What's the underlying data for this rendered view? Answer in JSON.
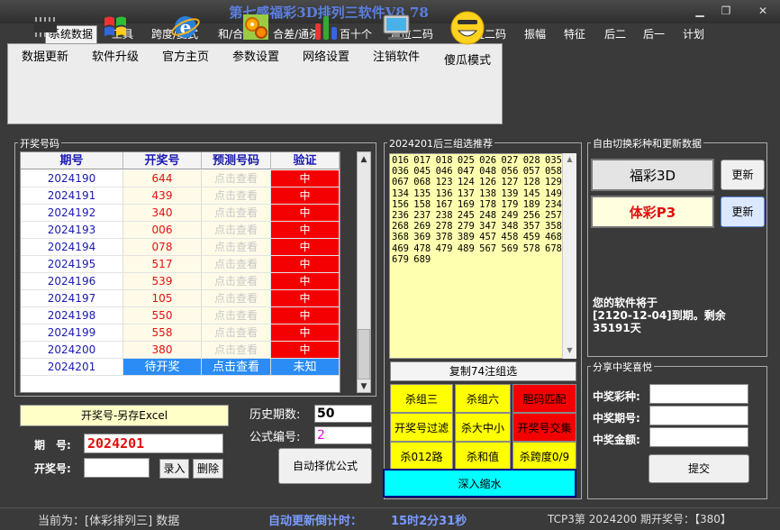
{
  "window": {
    "title": "第七感福彩3D排列三软件V8.78",
    "minimize": "▁",
    "maximize": "❐",
    "close": "✕"
  },
  "menu": [
    "系统数据",
    "工具",
    "跨度/复式",
    "和/合值",
    "合差/通杀",
    "百十个",
    "定位二码",
    "不定位二码",
    "振幅",
    "特征",
    "后二",
    "后一",
    "计划"
  ],
  "toolbar": [
    "数据更新",
    "软件升级",
    "官方主页",
    "参数设置",
    "网络设置",
    "注销软件",
    "傻瓜模式"
  ],
  "lottery_panel": {
    "title": "开奖号码",
    "headers": [
      "期号",
      "开奖号",
      "预测号码",
      "验证"
    ],
    "rows": [
      {
        "period": "2024190",
        "number": "644",
        "predict": "点击查看",
        "verify": "中"
      },
      {
        "period": "2024191",
        "number": "439",
        "predict": "点击查看",
        "verify": "中"
      },
      {
        "period": "2024192",
        "number": "340",
        "predict": "点击查看",
        "verify": "中"
      },
      {
        "period": "2024193",
        "number": "006",
        "predict": "点击查看",
        "verify": "中"
      },
      {
        "period": "2024194",
        "number": "078",
        "predict": "点击查看",
        "verify": "中"
      },
      {
        "period": "2024195",
        "number": "517",
        "predict": "点击查看",
        "verify": "中"
      },
      {
        "period": "2024196",
        "number": "539",
        "predict": "点击查看",
        "verify": "中"
      },
      {
        "period": "2024197",
        "number": "105",
        "predict": "点击查看",
        "verify": "中"
      },
      {
        "period": "2024198",
        "number": "550",
        "predict": "点击查看",
        "verify": "中"
      },
      {
        "period": "2024199",
        "number": "558",
        "predict": "点击查看",
        "verify": "中"
      },
      {
        "period": "2024200",
        "number": "380",
        "predict": "点击查看",
        "verify": "中"
      }
    ],
    "current_row": {
      "period": "2024201",
      "number": "待开奖",
      "predict": "点击查看",
      "verify": "未知"
    }
  },
  "bottom_left": {
    "excel_button": "开奖号-另存Excel",
    "period_label": "期　号:",
    "period_value": "2024201",
    "number_label": "开奖号:",
    "enter_button": "录入",
    "delete_button": "删除",
    "history_label": "历史期数:",
    "history_value": "50",
    "formula_label": "公式编号:",
    "formula_value": "2",
    "auto_button": "自动择优公式"
  },
  "recommend": {
    "title": "2024201后三组选推荐",
    "numbers": "016 017 018 025 026 027 028 035 036 045 046 047 048 056 057 058 067 068 123 124 126 127 128 129 134 135 136 137 138 139 145 149 156 158 167 169 178 179 189 234 236 237 238 245 248 249 256 257 268 269 278 279 347 348 357 358 368 369 378 389 457 458 459 468 469 478 479 489 567 569 578 678 679 689",
    "copy_button": "复制74注组选",
    "buttons": [
      {
        "label": "杀组三",
        "color": "yellow"
      },
      {
        "label": "杀组六",
        "color": "yellow"
      },
      {
        "label": "胆码匹配",
        "color": "red"
      },
      {
        "label": "开奖号过滤",
        "color": "yellow"
      },
      {
        "label": "杀大中小",
        "color": "yellow"
      },
      {
        "label": "开奖号交集",
        "color": "red"
      },
      {
        "label": "杀012路",
        "color": "yellow"
      },
      {
        "label": "杀和值",
        "color": "yellow"
      },
      {
        "label": "杀跨度0/9",
        "color": "yellow"
      }
    ],
    "deep_button": "深入缩水"
  },
  "switch_panel": {
    "title": "自由切换彩种和更新数据",
    "fc3d": "福彩3D",
    "tcp3": "体彩P3",
    "update": "更新",
    "expire_line1": "您的软件将于",
    "expire_line2": "[2120-12-04]到期。剩余",
    "expire_line3": "35191天"
  },
  "share_panel": {
    "title": "分享中奖喜悦",
    "kind_label": "中奖彩种:",
    "period_label": "中奖期号:",
    "amount_label": "中奖金额:",
    "submit": "提交"
  },
  "status": {
    "current": "当前为：[体彩排列三] 数据",
    "countdown_label": "自动更新倒计时：",
    "countdown": "15时2分31秒",
    "last": "TCP3第 2024200 期开奖号：【380】"
  }
}
